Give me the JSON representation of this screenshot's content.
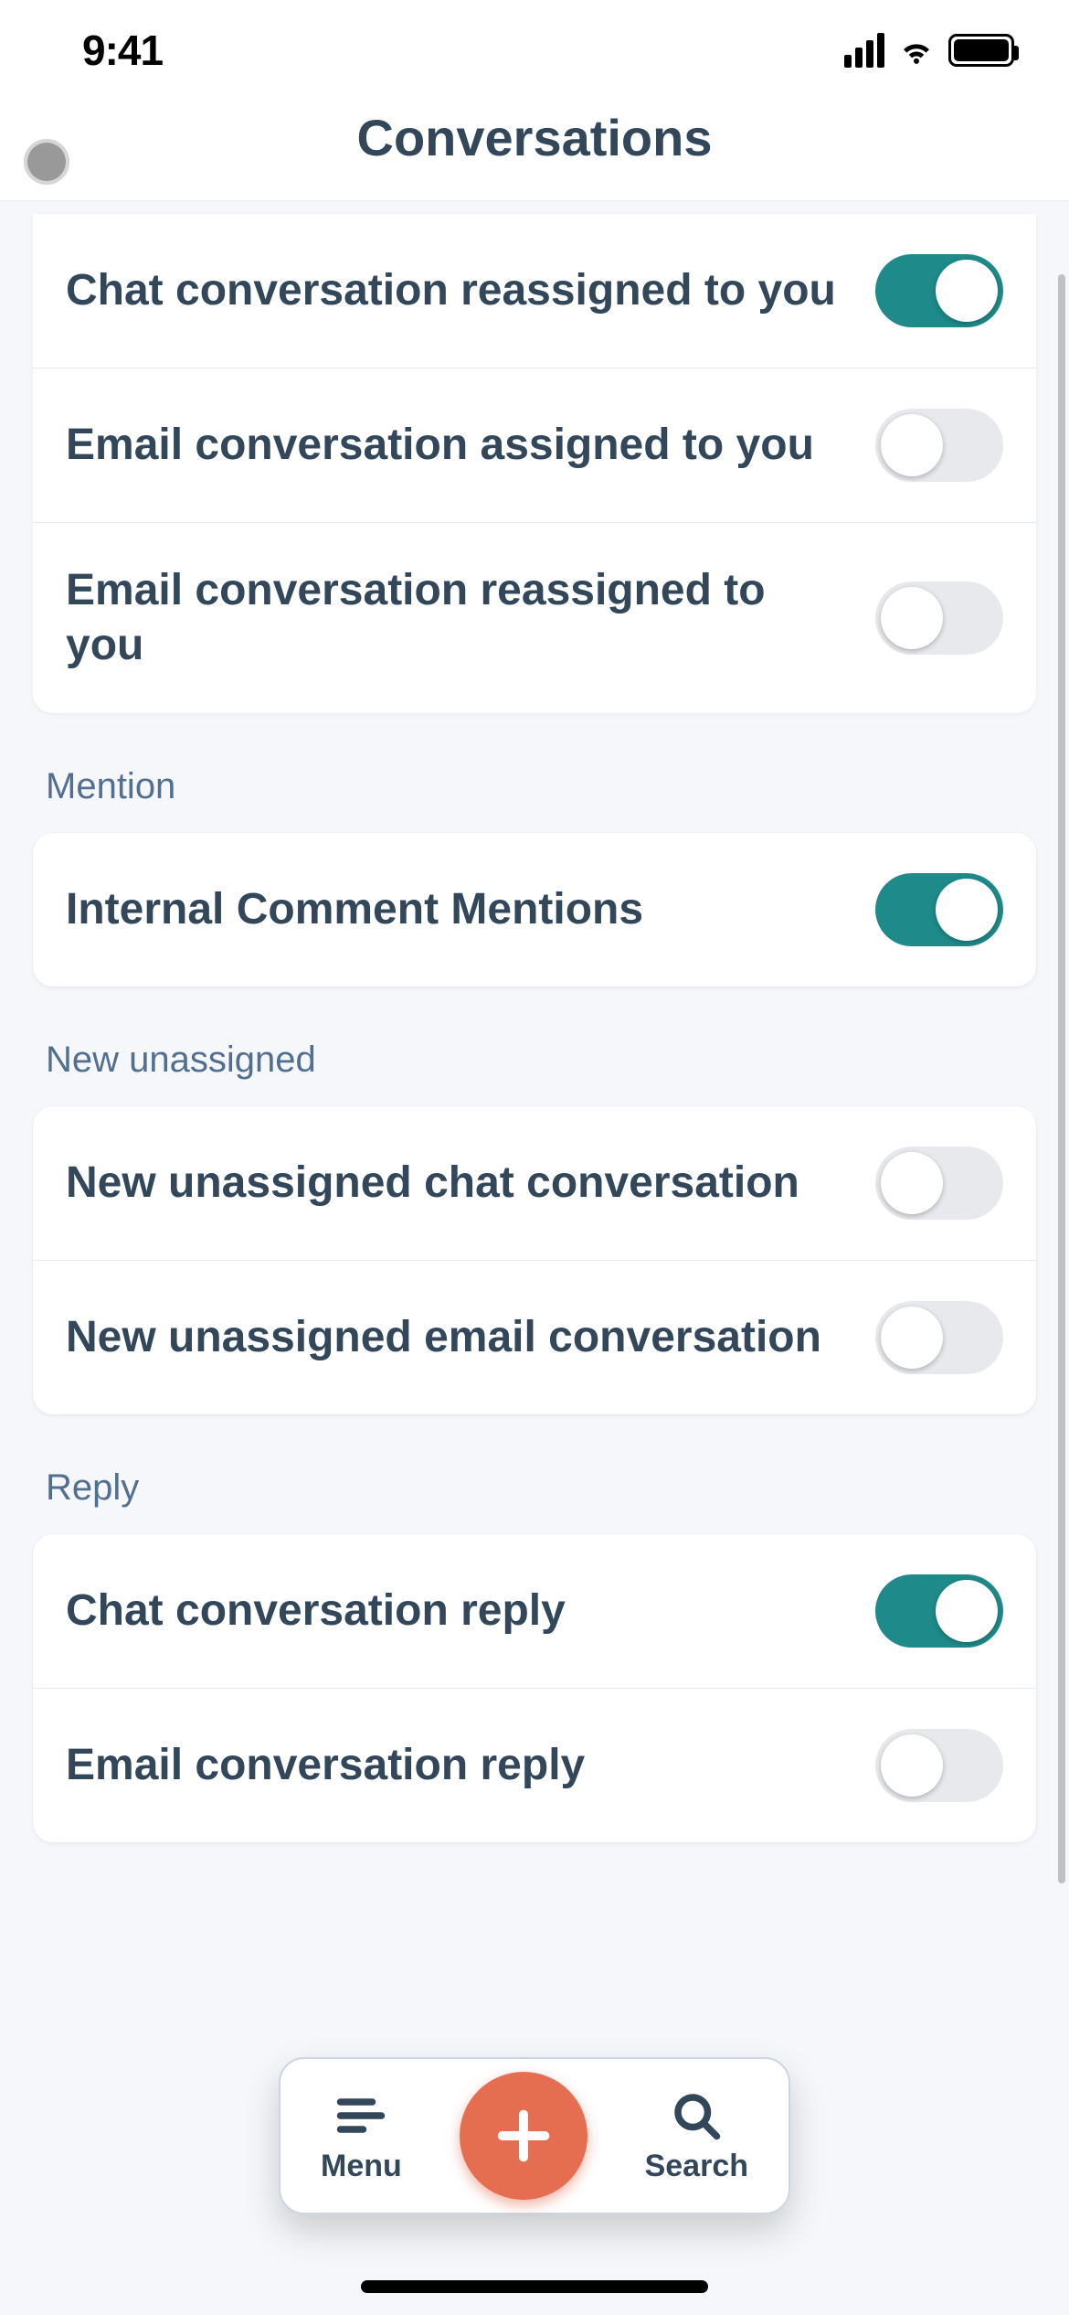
{
  "status": {
    "time": "9:41"
  },
  "header": {
    "title": "Conversations"
  },
  "colors": {
    "accent": "#1f8a8a",
    "fab": "#e66e50",
    "text": "#33475b"
  },
  "topCard": {
    "items": [
      {
        "label": "Chat conversation reassigned to you",
        "on": true
      },
      {
        "label": "Email conversation assigned to you",
        "on": false
      },
      {
        "label": "Email conversation reassigned to you",
        "on": false
      }
    ]
  },
  "sections": [
    {
      "title": "Mention",
      "items": [
        {
          "label": "Internal Comment Mentions",
          "on": true
        }
      ]
    },
    {
      "title": "New unassigned",
      "items": [
        {
          "label": "New unassigned chat conversation",
          "on": false
        },
        {
          "label": "New unassigned email conversation",
          "on": false
        }
      ]
    },
    {
      "title": "Reply",
      "items": [
        {
          "label": "Chat conversation reply",
          "on": true
        },
        {
          "label": "Email conversation reply",
          "on": false
        }
      ]
    }
  ],
  "bottomNav": {
    "menu": "Menu",
    "search": "Search",
    "addIcon": "plus-icon"
  }
}
